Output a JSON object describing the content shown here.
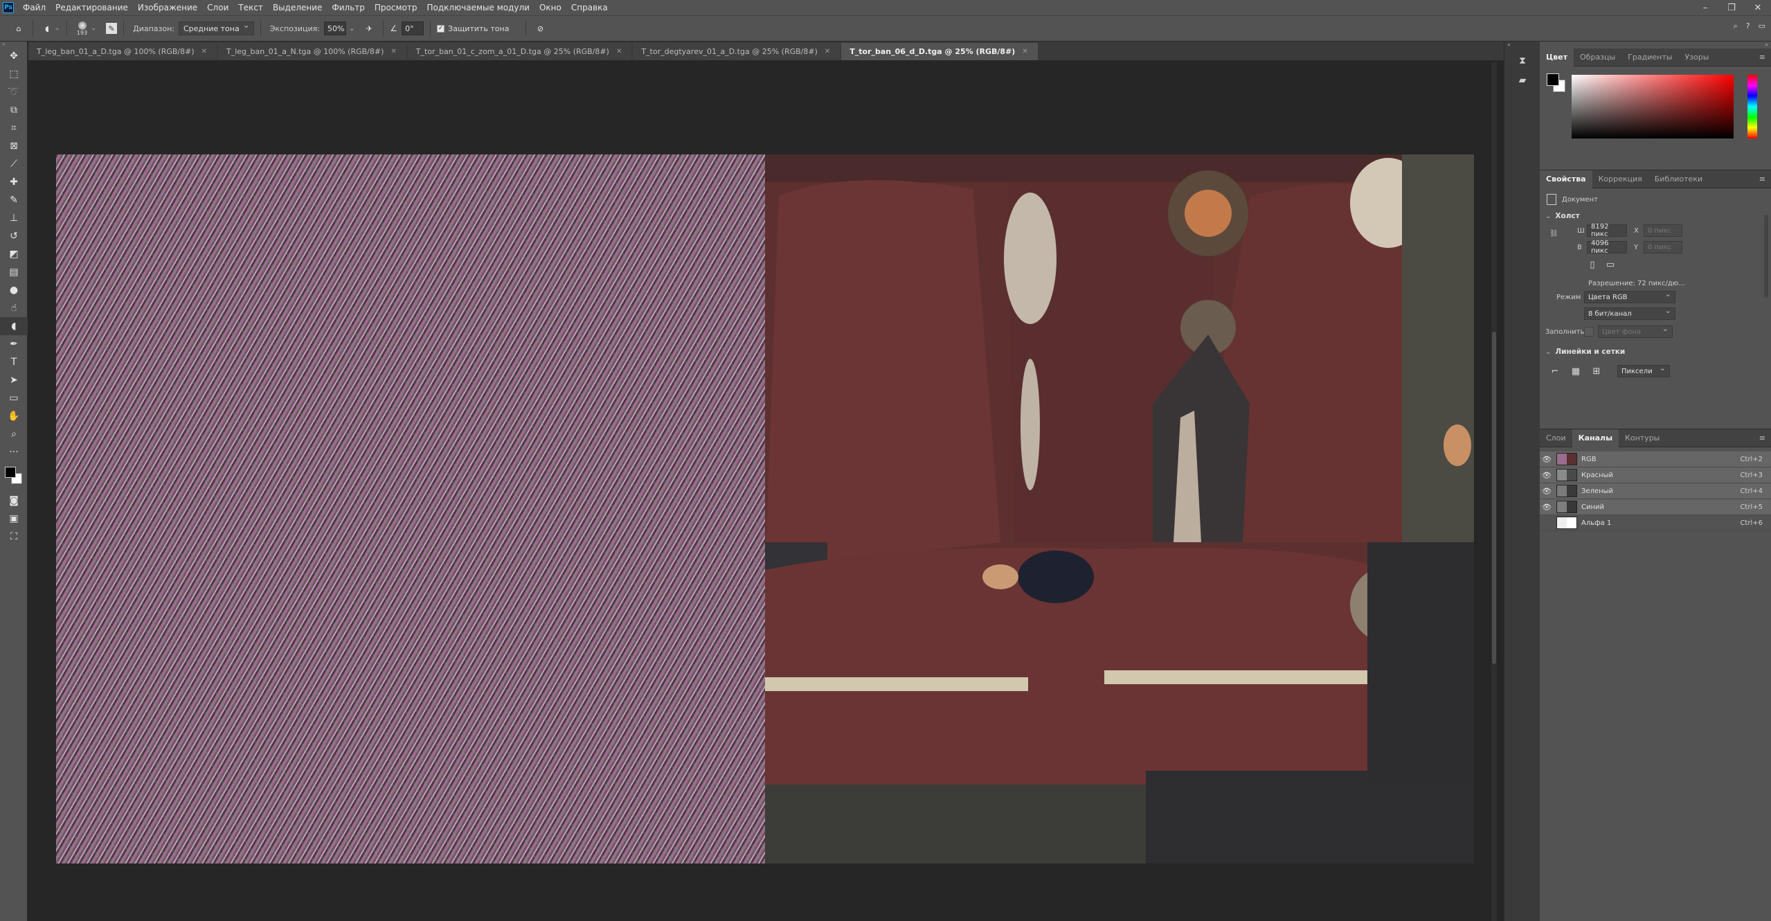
{
  "app": {
    "logo_text": "Ps"
  },
  "menu": [
    "Файл",
    "Редактирование",
    "Изображение",
    "Слои",
    "Текст",
    "Выделение",
    "Фильтр",
    "Просмотр",
    "Подключаемые модули",
    "Окно",
    "Справка"
  ],
  "options_bar": {
    "brush_size": "193",
    "range_label": "Диапазон:",
    "range_value": "Средние тона",
    "exposure_label": "Экспозиция:",
    "exposure_value": "50%",
    "angle_value": "0°",
    "protect_tones_label": "Защитить тона",
    "protect_tones_checked": true
  },
  "tabs": [
    {
      "label": "T_leg_ban_01_a_D.tga @ 100% (RGB/8#)",
      "active": false
    },
    {
      "label": "T_leg_ban_01_a_N.tga @ 100% (RGB/8#)",
      "active": false
    },
    {
      "label": "T_tor_ban_01_c_zom_a_01_D.tga @ 25% (RGB/8#)",
      "active": false
    },
    {
      "label": "T_tor_degtyarev_01_a_D.tga @ 25% (RGB/8#)",
      "active": false
    },
    {
      "label": "T_tor_ban_06_d_D.tga @ 25% (RGB/8#)",
      "active": true
    }
  ],
  "color_panel": {
    "tabs": [
      "Цвет",
      "Образцы",
      "Градиенты",
      "Узоры"
    ],
    "active_tab": "Цвет",
    "foreground": "#000000",
    "background": "#ffffff"
  },
  "properties_panel": {
    "tabs": [
      "Свойства",
      "Коррекция",
      "Библиотеки"
    ],
    "active_tab": "Свойства",
    "doc_label": "Документ",
    "canvas_section": "Холст",
    "width_label": "Ш",
    "width_value": "8192 пикс",
    "height_label": "В",
    "height_value": "4096 пикс",
    "x_label": "X",
    "x_placeholder": "0 пикс",
    "y_label": "Y",
    "y_placeholder": "0 пикс",
    "resolution": "Разрешение: 72 пикс/дю...",
    "mode_label": "Режим",
    "mode_value": "Цвета RGB",
    "bits_value": "8 бит/канал",
    "fill_label": "Заполнить",
    "fill_value": "Цвет фона",
    "rulers_section": "Линейки и сетки",
    "units_value": "Пиксели"
  },
  "channels_panel": {
    "tabs": [
      "Слои",
      "Каналы",
      "Контуры"
    ],
    "active_tab": "Каналы",
    "channels": [
      {
        "name": "RGB",
        "shortcut": "Ctrl+2",
        "visible": true,
        "selected": true
      },
      {
        "name": "Красный",
        "shortcut": "Ctrl+3",
        "visible": true,
        "selected": true
      },
      {
        "name": "Зеленый",
        "shortcut": "Ctrl+4",
        "visible": true,
        "selected": true
      },
      {
        "name": "Синий",
        "shortcut": "Ctrl+5",
        "visible": true,
        "selected": true
      },
      {
        "name": "Альфа 1",
        "shortcut": "Ctrl+6",
        "visible": false,
        "selected": false
      }
    ]
  },
  "icons": {
    "tools": [
      "move-icon",
      "marquee-icon",
      "lasso-icon",
      "object-select-icon",
      "crop-icon",
      "frame-icon",
      "eyedropper-icon",
      "healing-brush-icon",
      "brush-icon",
      "clone-stamp-icon",
      "history-brush-icon",
      "eraser-icon",
      "gradient-icon",
      "blur-icon",
      "smudge-icon",
      "dodge-icon",
      "pen-icon",
      "type-icon",
      "path-select-icon",
      "rectangle-icon",
      "hand-icon",
      "zoom-icon",
      "more-tools-icon"
    ]
  }
}
